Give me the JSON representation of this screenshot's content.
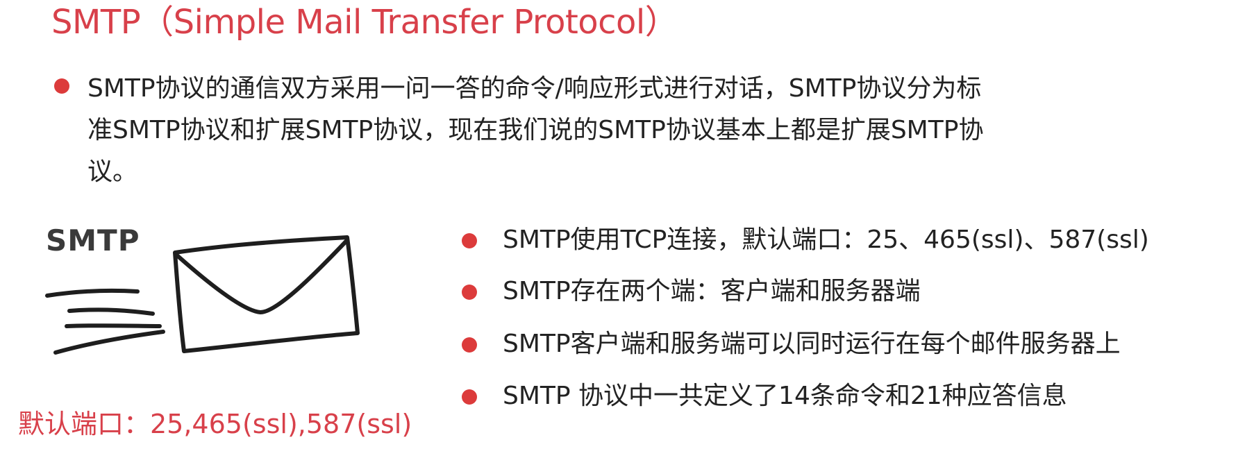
{
  "title": "SMTP（Simple Mail Transfer Protocol）",
  "intro": {
    "lines": [
      "SMTP协议的通信双方采用一问一答的命令/响应形式进行对话，SMTP协议分为标",
      "准SMTP协议和扩展SMTP协议，现在我们说的SMTP协议基本上都是扩展SMTP协",
      "议。"
    ]
  },
  "illustration": {
    "label": "SMTP",
    "icon": "envelope-icon"
  },
  "points": [
    "SMTP使用TCP连接，默认端口：25、465(ssl)、587(ssl)",
    "SMTP存在两个端：客户端和服务器端",
    "SMTP客户端和服务端可以同时运行在每个邮件服务器上",
    "SMTP 协议中一共定义了14条命令和21种应答信息"
  ],
  "port_note": "默认端口：25,465(ssl),587(ssl)",
  "colors": {
    "accent": "#d8404a",
    "bullet": "#dc3b3b",
    "text": "#222222"
  }
}
